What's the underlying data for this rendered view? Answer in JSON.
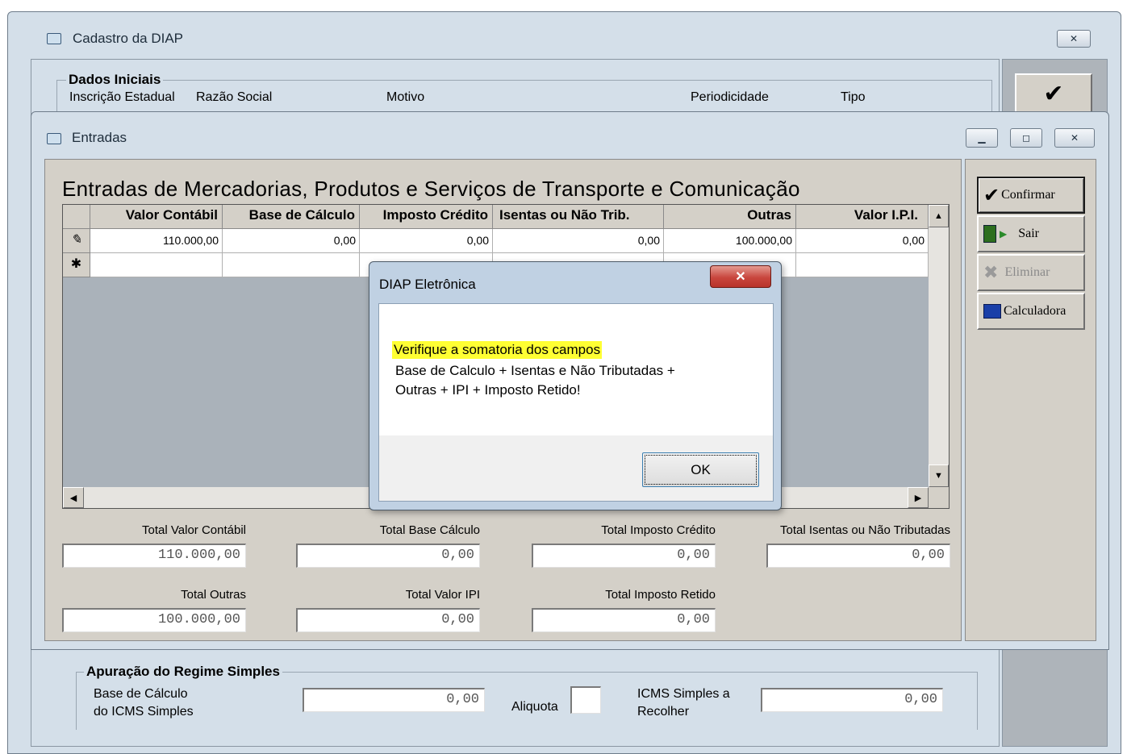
{
  "outer_window": {
    "title": "Cadastro da DIAP",
    "group_title": "Dados Iniciais",
    "labels": [
      "Inscrição Estadual",
      "Razão Social",
      "Motivo",
      "Periodicidade",
      "Tipo"
    ],
    "side_check": "✔"
  },
  "simples": {
    "group_title": "Apuração do Regime Simples",
    "base_label_1": "Base de Cálculo",
    "base_label_2": "do ICMS Simples",
    "base_value": "0,00",
    "aliquota_label": "Aliquota",
    "aliquota_value": "",
    "icms_label_1": "ICMS Simples a",
    "icms_label_2": "Recolher",
    "icms_value": "0,00"
  },
  "entradas_window": {
    "title": "Entradas",
    "heading": "Entradas de Mercadorias, Produtos e Serviços de Transporte e Comunicação",
    "grid": {
      "columns": [
        "Valor Contábil",
        "Base de Cálculo",
        "Imposto Crédito",
        "Isentas ou Não Trib.",
        "Outras",
        "Valor I.P.I."
      ],
      "rows": [
        {
          "indicator": "✎",
          "cells": [
            "110.000,00",
            "0,00",
            "0,00",
            "0,00",
            "100.000,00",
            "0,00"
          ]
        },
        {
          "indicator": "✱",
          "cells": [
            "",
            "",
            "",
            "",
            "",
            ""
          ]
        }
      ]
    },
    "buttons": {
      "confirmar": "Confirmar",
      "sair": "Sair",
      "eliminar": "Eliminar",
      "calculadora": "Calculadora"
    },
    "totals": {
      "valor_contabil_label": "Total Valor Contábil",
      "valor_contabil": "110.000,00",
      "base_calculo_label": "Total Base Cálculo",
      "base_calculo": "0,00",
      "imposto_credito_label": "Total Imposto Crédito",
      "imposto_credito": "0,00",
      "isentas_label": "Total Isentas ou Não Tributadas",
      "isentas": "0,00",
      "outras_label": "Total Outras",
      "outras": "100.000,00",
      "valor_ipi_label": "Total Valor IPI",
      "valor_ipi": "0,00",
      "imposto_retido_label": "Total Imposto Retido",
      "imposto_retido": "0,00"
    }
  },
  "dialog": {
    "title": "DIAP Eletrônica",
    "close_glyph": "✕",
    "message_highlight": "Verifique a somatoria dos campos",
    "message_line2": "Base de Calculo + Isentas e Não Tributadas +",
    "message_line3": "Outras + IPI + Imposto Retido!",
    "ok_label": "OK"
  },
  "colors": {
    "highlight": "#ffff33",
    "window_frame": "#d4dfe9",
    "close_button": "#c9463d"
  }
}
